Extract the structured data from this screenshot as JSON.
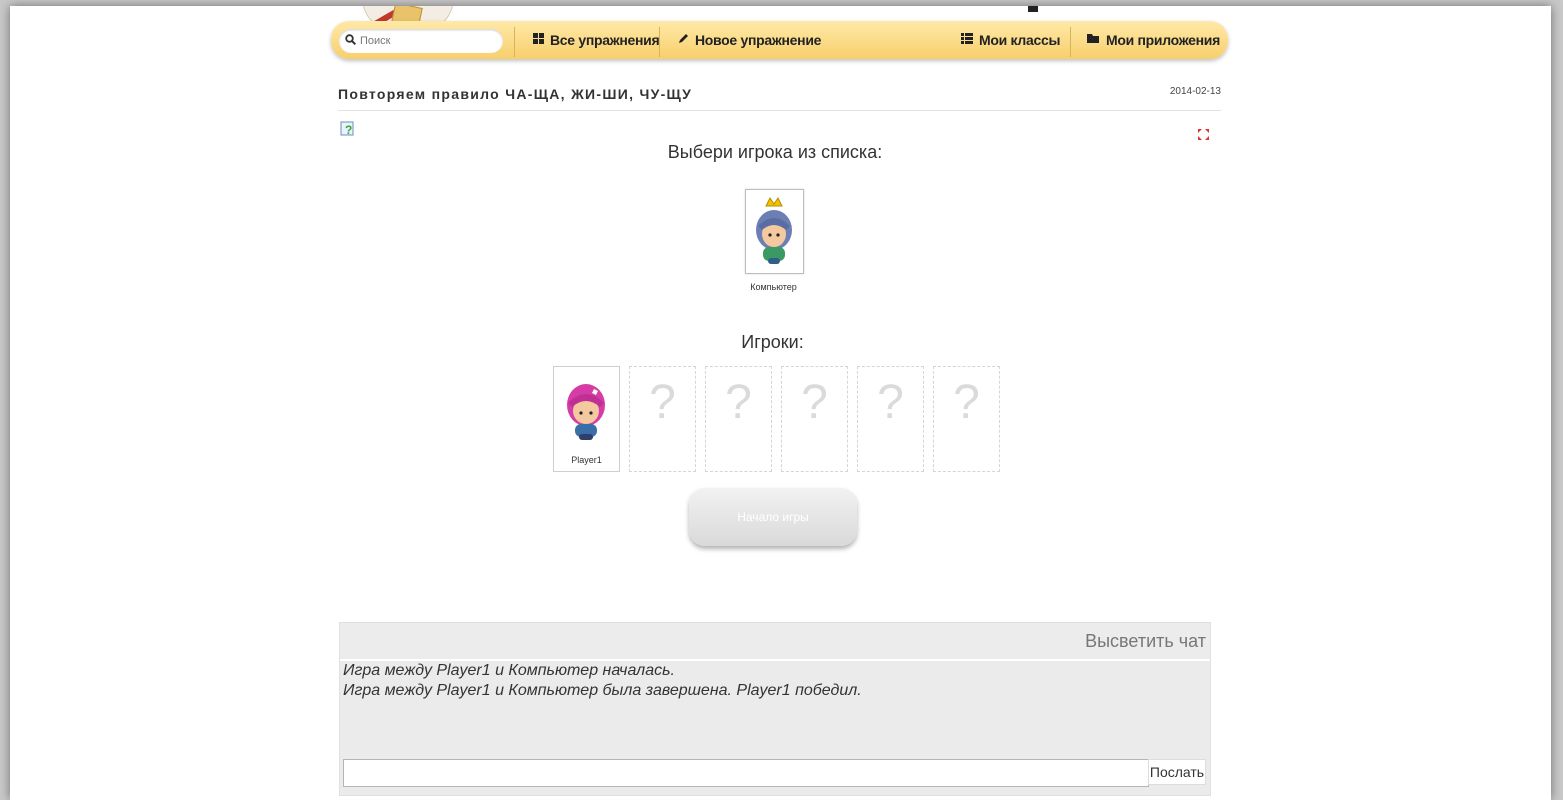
{
  "navbar": {
    "search_placeholder": "Поиск",
    "items": [
      {
        "label": "Все упражнения",
        "icon": "grid-icon"
      },
      {
        "label": "Новое упражнение",
        "icon": "pencil-icon"
      },
      {
        "label": "Мои классы",
        "icon": "list-icon"
      },
      {
        "label": "Мои приложения",
        "icon": "folder-icon"
      }
    ]
  },
  "page": {
    "title": "Повторяем правило ЧА-ЩА, ЖИ-ШИ, ЧУ-ЩУ",
    "date": "2014-02-13"
  },
  "game": {
    "prompt": "Выбери игрока из списка:",
    "computer_label": "Компьютер",
    "players_label": "Игроки:",
    "player1_label": "Player1",
    "empty_slot_symbol": "?",
    "start_button": "Начало игры"
  },
  "chat": {
    "toggle_label": "Высветить чат",
    "messages": [
      "Игра между Player1 и Компьютер началась.",
      "Игра между Player1 и Компьютер была завершена. Player1 победил."
    ],
    "send_label": "Послать"
  },
  "colors": {
    "navbar_top": "#ffe9a8",
    "navbar_bottom": "#f7cf6c",
    "computer_hair": "#6b7fb5",
    "player_hair": "#d63ca6"
  }
}
